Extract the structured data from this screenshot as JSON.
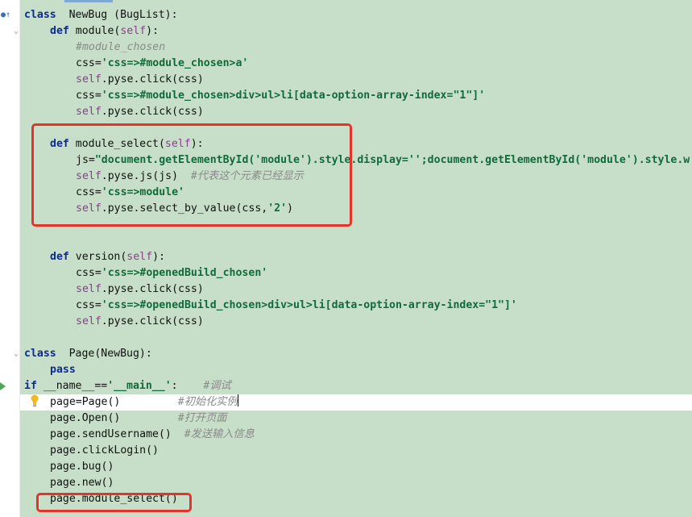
{
  "editor": {
    "lines": [
      {
        "indent": 0,
        "tokens": [
          {
            "t": "class",
            "c": "kw"
          },
          {
            "t": "  NewBug (BugList):",
            "c": ""
          }
        ]
      },
      {
        "indent": 1,
        "tokens": [
          {
            "t": "def",
            "c": "kw"
          },
          {
            "t": " module(",
            "c": ""
          },
          {
            "t": "self",
            "c": "self"
          },
          {
            "t": "):",
            "c": ""
          }
        ]
      },
      {
        "indent": 2,
        "tokens": [
          {
            "t": "#module_chosen",
            "c": "cmt"
          }
        ]
      },
      {
        "indent": 2,
        "tokens": [
          {
            "t": "css=",
            "c": ""
          },
          {
            "t": "'css=>#module_chosen>a'",
            "c": "str"
          }
        ]
      },
      {
        "indent": 2,
        "tokens": [
          {
            "t": "self",
            "c": "self"
          },
          {
            "t": ".pyse.click(css)",
            "c": ""
          }
        ]
      },
      {
        "indent": 2,
        "tokens": [
          {
            "t": "css=",
            "c": ""
          },
          {
            "t": "'css=>#module_chosen>div>ul>li[data-option-array-index=\"1\"]'",
            "c": "str"
          }
        ]
      },
      {
        "indent": 2,
        "tokens": [
          {
            "t": "self",
            "c": "self"
          },
          {
            "t": ".pyse.click(css)",
            "c": ""
          }
        ]
      },
      {
        "indent": 0,
        "tokens": []
      },
      {
        "indent": 1,
        "tokens": [
          {
            "t": "def",
            "c": "kw"
          },
          {
            "t": " module_select(",
            "c": ""
          },
          {
            "t": "self",
            "c": "self"
          },
          {
            "t": "):",
            "c": ""
          }
        ]
      },
      {
        "indent": 2,
        "tokens": [
          {
            "t": "js=",
            "c": ""
          },
          {
            "t": "\"document.getElementById('module').style.display='';document.getElementById('module').style.w",
            "c": "str"
          }
        ]
      },
      {
        "indent": 2,
        "tokens": [
          {
            "t": "self",
            "c": "self"
          },
          {
            "t": ".pyse.js(js)  ",
            "c": ""
          },
          {
            "t": "#代表这个元素已经显示",
            "c": "cmt"
          }
        ]
      },
      {
        "indent": 2,
        "tokens": [
          {
            "t": "css=",
            "c": ""
          },
          {
            "t": "'css=>module'",
            "c": "str"
          }
        ]
      },
      {
        "indent": 2,
        "tokens": [
          {
            "t": "self",
            "c": "self"
          },
          {
            "t": ".pyse.select_by_value(css,",
            "c": ""
          },
          {
            "t": "'2'",
            "c": "str"
          },
          {
            "t": ")",
            "c": ""
          }
        ]
      },
      {
        "indent": 0,
        "tokens": []
      },
      {
        "indent": 0,
        "tokens": []
      },
      {
        "indent": 1,
        "tokens": [
          {
            "t": "def",
            "c": "kw"
          },
          {
            "t": " version(",
            "c": ""
          },
          {
            "t": "self",
            "c": "self"
          },
          {
            "t": "):",
            "c": ""
          }
        ]
      },
      {
        "indent": 2,
        "tokens": [
          {
            "t": "css=",
            "c": ""
          },
          {
            "t": "'css=>#openedBuild_chosen'",
            "c": "str"
          }
        ]
      },
      {
        "indent": 2,
        "tokens": [
          {
            "t": "self",
            "c": "self"
          },
          {
            "t": ".pyse.click(css)",
            "c": ""
          }
        ]
      },
      {
        "indent": 2,
        "tokens": [
          {
            "t": "css=",
            "c": ""
          },
          {
            "t": "'css=>#openedBuild_chosen>div>ul>li[data-option-array-index=\"1\"]'",
            "c": "str"
          }
        ]
      },
      {
        "indent": 2,
        "tokens": [
          {
            "t": "self",
            "c": "self"
          },
          {
            "t": ".pyse.click(css)",
            "c": ""
          }
        ]
      },
      {
        "indent": 0,
        "tokens": []
      },
      {
        "indent": 0,
        "tokens": [
          {
            "t": "class",
            "c": "kw"
          },
          {
            "t": "  Page(NewBug):",
            "c": ""
          }
        ]
      },
      {
        "indent": 1,
        "tokens": [
          {
            "t": "pass",
            "c": "kw"
          }
        ]
      },
      {
        "indent": 0,
        "tokens": [
          {
            "t": "if",
            "c": "kw"
          },
          {
            "t": " __name__==",
            "c": ""
          },
          {
            "t": "'__main__'",
            "c": "str"
          },
          {
            "t": ":    ",
            "c": ""
          },
          {
            "t": "#调试",
            "c": "cmt"
          }
        ]
      },
      {
        "indent": 1,
        "tokens": [
          {
            "t": "page=Page()         ",
            "c": ""
          },
          {
            "t": "#初始化实例",
            "c": "cmt"
          }
        ],
        "current": true
      },
      {
        "indent": 1,
        "tokens": [
          {
            "t": "page.Open()         ",
            "c": ""
          },
          {
            "t": "#打开页面",
            "c": "cmt"
          }
        ]
      },
      {
        "indent": 1,
        "tokens": [
          {
            "t": "page.sendUsername()  ",
            "c": ""
          },
          {
            "t": "#发送输入信息",
            "c": "cmt"
          }
        ]
      },
      {
        "indent": 1,
        "tokens": [
          {
            "t": "page.clickLogin()",
            "c": ""
          }
        ]
      },
      {
        "indent": 1,
        "tokens": [
          {
            "t": "page.bug()",
            "c": ""
          }
        ]
      },
      {
        "indent": 1,
        "tokens": [
          {
            "t": "page.new()",
            "c": ""
          }
        ]
      },
      {
        "indent": 1,
        "tokens": [
          {
            "t": "page.module_select()",
            "c": ""
          }
        ]
      }
    ]
  },
  "gutter": {
    "icons": [
      "override-icon",
      "fold-icon",
      "run-icon",
      "intention-bulb-icon"
    ]
  },
  "colors": {
    "highlight_bg": "#c7dfc8",
    "keyword": "#0c2a96",
    "string": "#106b3a",
    "self": "#8a3f8c",
    "comment": "#8a8a8a",
    "annotation_box": "#e5332c"
  }
}
